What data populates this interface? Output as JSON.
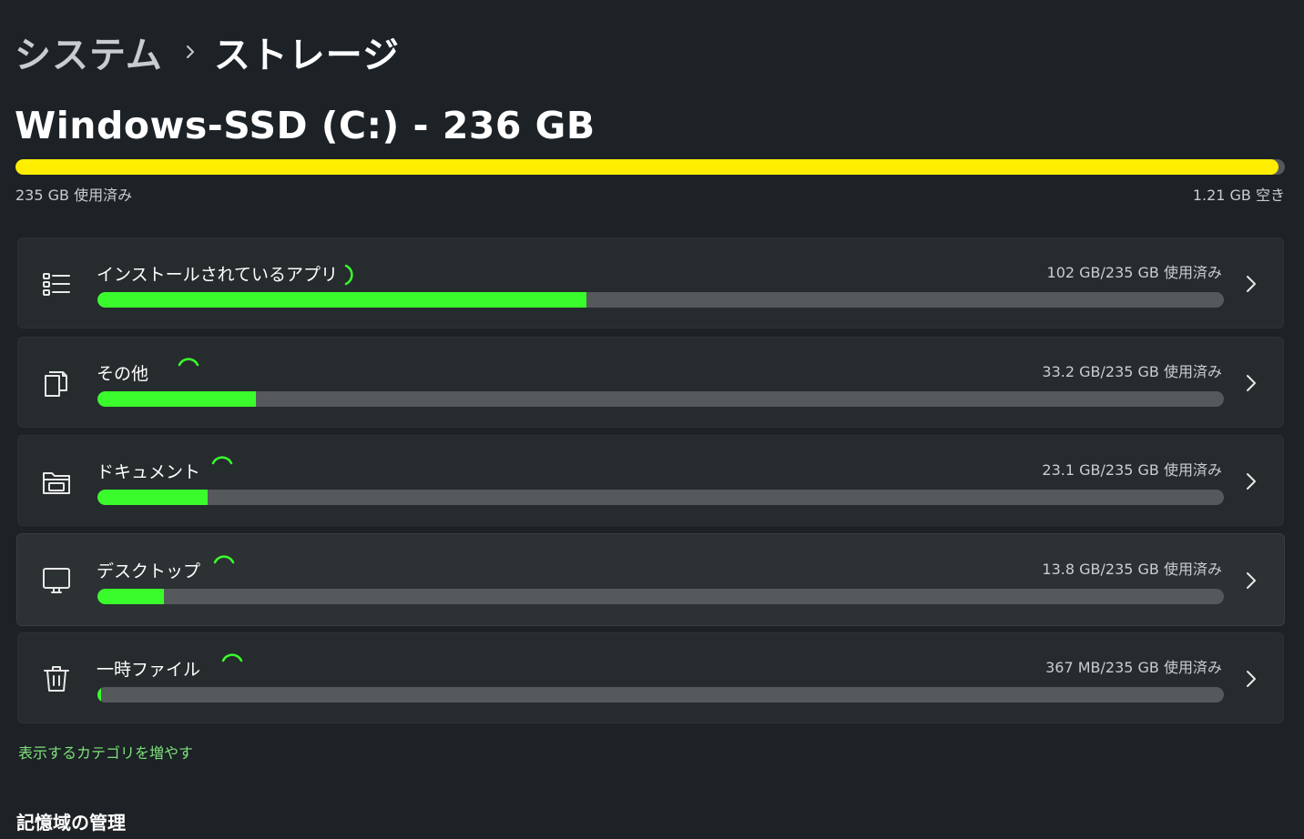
{
  "breadcrumb": {
    "parent": "システム",
    "current": "ストレージ"
  },
  "drive": {
    "title": "Windows-SSD (C:) - 236 GB",
    "used_label": "235 GB 使用済み",
    "free_label": "1.21 GB 空き",
    "used_fraction": 0.995
  },
  "categories": [
    {
      "label": "インストールされているアプリ",
      "usage": "102 GB/235 GB 使用済み",
      "fraction": 0.434,
      "icon": "apps-list-icon"
    },
    {
      "label": "その他",
      "usage": "33.2 GB/235 GB 使用済み",
      "fraction": 0.141,
      "icon": "other-files-icon"
    },
    {
      "label": "ドキュメント",
      "usage": "23.1 GB/235 GB 使用済み",
      "fraction": 0.098,
      "icon": "documents-folder-icon"
    },
    {
      "label": "デスクトップ",
      "usage": "13.8 GB/235 GB 使用済み",
      "fraction": 0.059,
      "icon": "desktop-monitor-icon"
    },
    {
      "label": "一時ファイル",
      "usage": "367 MB/235 GB 使用済み",
      "fraction": 0.0016,
      "icon": "trash-icon"
    }
  ],
  "more_link": "表示するカテゴリを増やす",
  "section_title": "記憶域の管理",
  "colors": {
    "drive_bar": "#ffee00",
    "category_bar": "#3afc2c",
    "link": "#7fe07a",
    "background": "#1c2226"
  }
}
